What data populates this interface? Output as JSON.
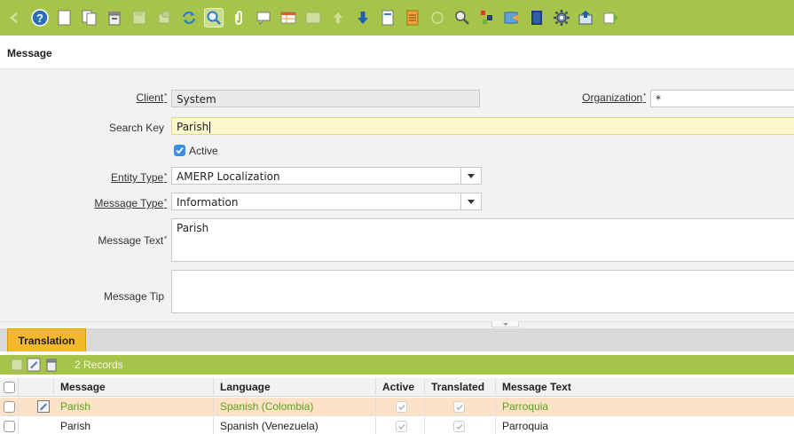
{
  "toolbar": {
    "buttons": [
      "back-icon",
      "help-icon",
      "new-record-icon",
      "copy-record-icon",
      "delete-icon",
      "save-icon",
      "undo-icon",
      "refresh-icon",
      "find-icon",
      "attachment-icon",
      "chat-icon",
      "grid-toggle-icon",
      "history-icon",
      "parent-icon",
      "detail-icon",
      "report-icon",
      "archive-icon",
      "print-icon",
      "zoom-across-icon",
      "request-icon",
      "product-info-icon",
      "workflow-icon",
      "process-icon",
      "export-icon",
      "import-icon"
    ]
  },
  "window": {
    "title": "Message"
  },
  "form": {
    "client": {
      "label": "Client",
      "value": "System"
    },
    "organization": {
      "label": "Organization",
      "value": "*"
    },
    "search_key": {
      "label": "Search Key",
      "value": "Parish"
    },
    "active": {
      "label": "Active",
      "checked": true
    },
    "entity_type": {
      "label": "Entity Type",
      "value": "AMERP Localization"
    },
    "message_type": {
      "label": "Message Type",
      "value": "Information"
    },
    "message_text": {
      "label": "Message Text",
      "value": "Parish"
    },
    "message_tip": {
      "label": "Message Tip",
      "value": ""
    }
  },
  "tabs": [
    {
      "label": "Translation",
      "active": true
    }
  ],
  "grid": {
    "record_count": "2 Records",
    "columns": [
      "Message",
      "Language",
      "Active",
      "Translated",
      "Message Text"
    ],
    "rows": [
      {
        "message": "Parish",
        "language": "Spanish (Colombia)",
        "active": true,
        "translated": true,
        "message_text": "Parroquia",
        "selected": true
      },
      {
        "message": "Parish",
        "language": "Spanish (Venezuela)",
        "active": true,
        "translated": true,
        "message_text": "Parroquia",
        "selected": false
      }
    ]
  },
  "colors": {
    "toolbar": "#a6c44a",
    "tab_active": "#f4b82e",
    "row_selected": "#fde2c8",
    "row_selected_text": "#57a21e",
    "field_focus": "#fdf8cc"
  }
}
